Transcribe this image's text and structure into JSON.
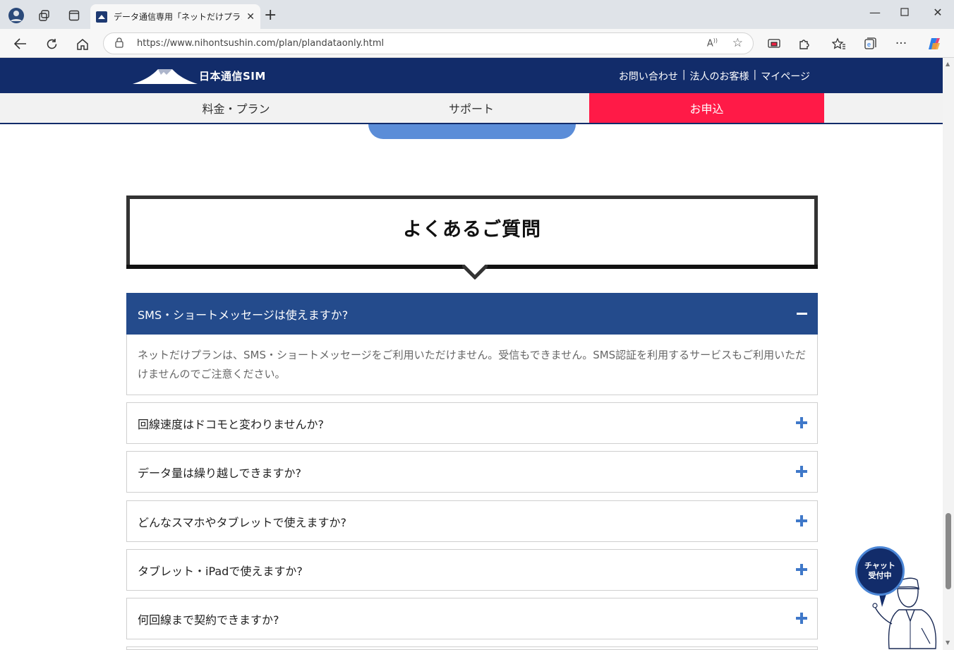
{
  "browser": {
    "tab_title": "データ通信専用「ネットだけプラン」| E",
    "url": "https://www.nihontsushin.com/plan/plandataonly.html"
  },
  "site": {
    "logo_text": "日本通信SIM",
    "top_links": [
      "お問い合わせ",
      "法人のお客様",
      "マイページ"
    ],
    "nav": {
      "plans": "料金・プラン",
      "support": "サポート",
      "apply": "お申込"
    },
    "brand_colors": {
      "navy": "#122c6a",
      "apply": "#ff1a47",
      "faq_open": "#244b8c",
      "plus": "#3f78c9"
    }
  },
  "faq": {
    "title": "よくあるご質問",
    "open_question": "SMS・ショートメッセージは使えますか?",
    "open_answer": "ネットだけプランは、SMS・ショートメッセージをご利用いただけません。受信もできません。SMS認証を利用するサービスもご利用いただけませんのでご注意ください。",
    "questions": [
      "回線速度はドコモと変わりませんか?",
      "データ量は繰り越しできますか?",
      "どんなスマホやタブレットで使えますか?",
      "タブレット・iPadで使えますか?",
      "何回線まで契約できますか?"
    ]
  },
  "chat": {
    "line1": "チャット",
    "line2": "受付中"
  }
}
